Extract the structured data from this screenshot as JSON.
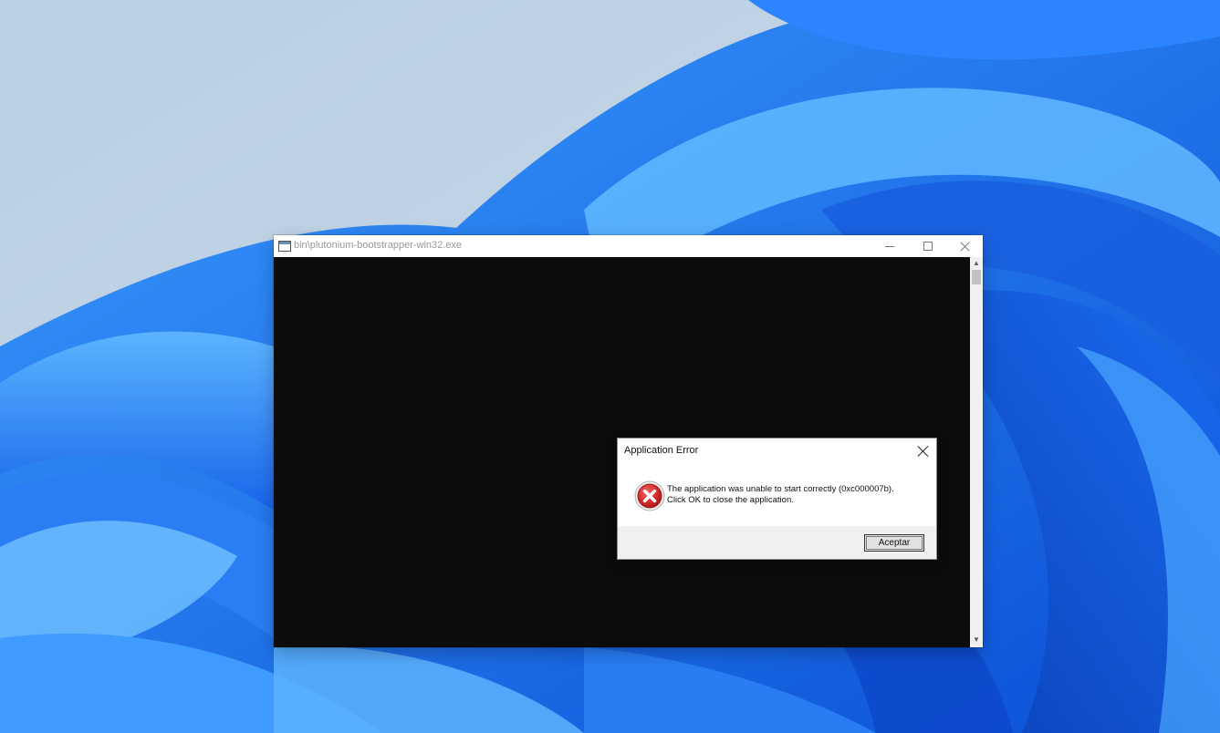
{
  "console_window": {
    "title": "bin\\plutonium-bootstrapper-win32.exe",
    "app_icon": "console-app-icon",
    "controls": {
      "minimize_icon": "minimize-icon",
      "maximize_icon": "maximize-icon",
      "close_icon": "close-icon"
    },
    "background_color": "#0c0c0c"
  },
  "error_dialog": {
    "title": "Application Error",
    "icon": "error-icon",
    "message_line1": "The application was unable to start correctly (0xc000007b).",
    "message_line2": "Click OK to close the application.",
    "ok_button_label": "Aceptar",
    "close_icon": "close-icon"
  },
  "colors": {
    "wallpaper_blue": "#1e6ff0",
    "wallpaper_sky": "#c5d9ea",
    "error_red": "#d42b2b"
  }
}
